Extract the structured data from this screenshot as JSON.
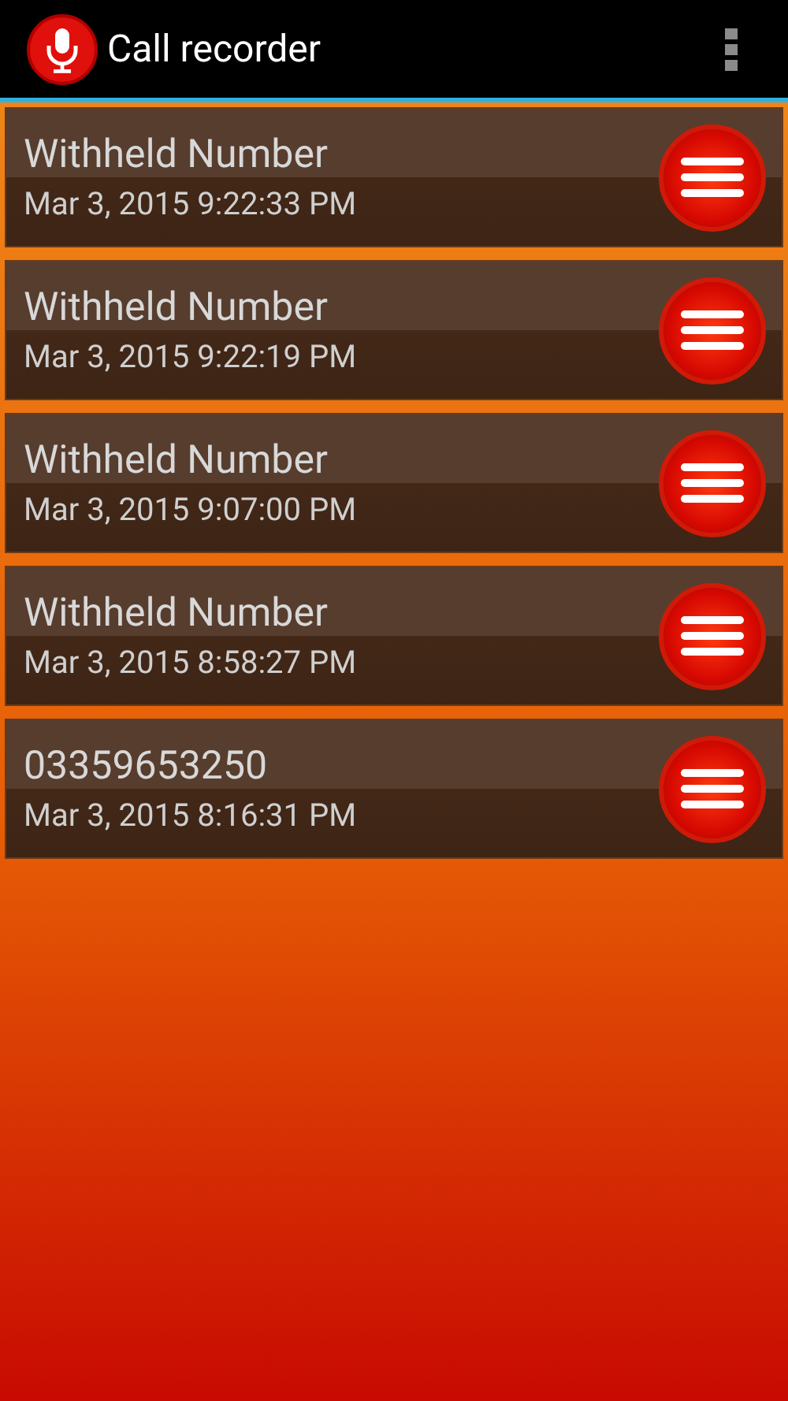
{
  "action_bar": {
    "title": "Call recorder"
  },
  "recordings": [
    {
      "caller": "Withheld Number",
      "time": "Mar 3, 2015 9:22:33 PM"
    },
    {
      "caller": "Withheld Number",
      "time": "Mar 3, 2015 9:22:19 PM"
    },
    {
      "caller": "Withheld Number",
      "time": "Mar 3, 2015 9:07:00 PM"
    },
    {
      "caller": "Withheld Number",
      "time": "Mar 3, 2015 8:58:27 PM"
    },
    {
      "caller": "03359653250",
      "time": "Mar 3, 2015 8:16:31 PM"
    }
  ]
}
